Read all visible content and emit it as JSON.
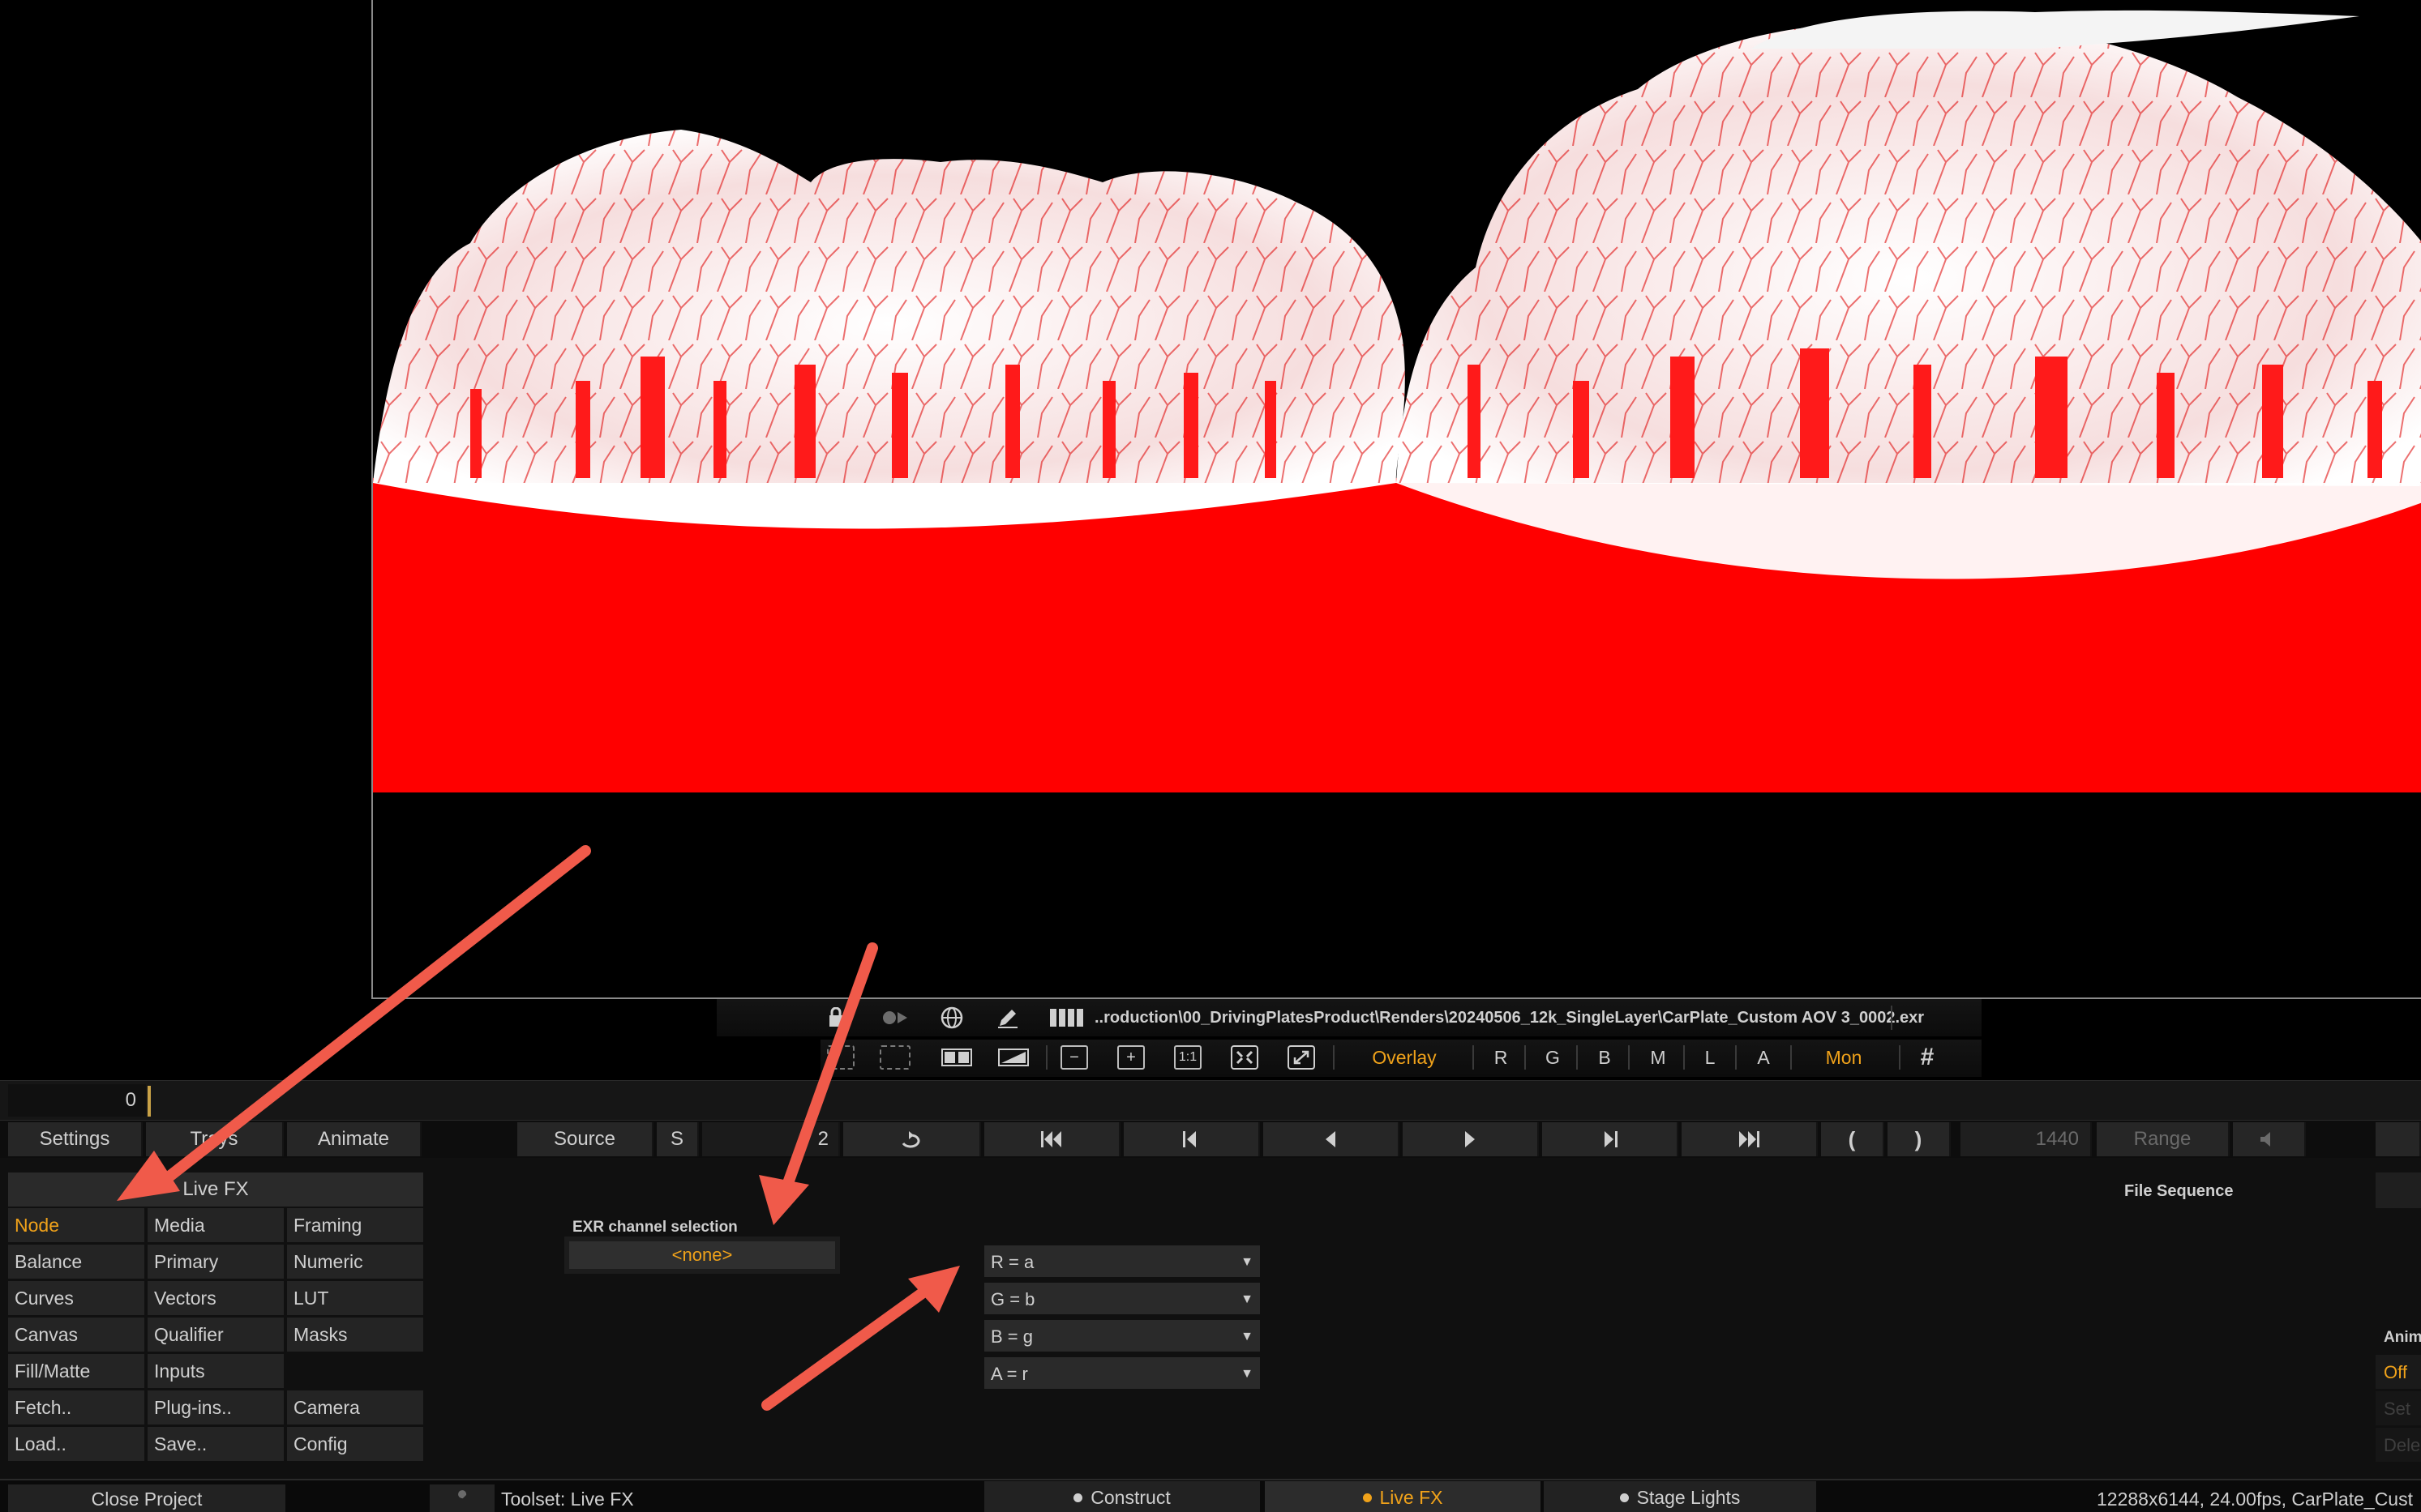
{
  "viewer": {
    "file_path": "..roduction\\00_DrivingPlatesProduct\\Renders\\20240506_12k_SingleLayer\\CarPlate_Custom AOV 3_0002.exr",
    "overlay_label": "Overlay",
    "channels": [
      "R",
      "G",
      "B",
      "M",
      "L",
      "A"
    ],
    "mon_label": "Mon",
    "zoom_1to1": "1:1",
    "icons": [
      "lock-icon",
      "record-icon",
      "globe-icon",
      "pen-icon",
      "filmstrip-icon",
      "safe-area-icon",
      "frame-icon",
      "split-view-icon",
      "gradient-icon",
      "zoom-out-icon",
      "zoom-in-icon",
      "fit-icon",
      "fullscreen-icon",
      "grid-icon"
    ],
    "accent": "#f0a21a",
    "plate_color": "#ff0000"
  },
  "timeline": {
    "frame": "0"
  },
  "transport": {
    "settings": "Settings",
    "trays": "Trays",
    "animate": "Animate",
    "source": "Source",
    "s": "S",
    "current_frame": "2",
    "end_frame": "1440",
    "range": "Range"
  },
  "menu": {
    "header": "Live FX",
    "items": [
      [
        "Node",
        "Media",
        "Framing"
      ],
      [
        "Balance",
        "Primary",
        "Numeric"
      ],
      [
        "Curves",
        "Vectors",
        "LUT"
      ],
      [
        "Canvas",
        "Qualifier",
        "Masks"
      ],
      [
        "Fill/Matte",
        "Inputs",
        ""
      ],
      [
        "Fetch..",
        "Plug-ins..",
        "Camera"
      ],
      [
        "Load..",
        "Save..",
        "Config"
      ]
    ],
    "active_item": "Node"
  },
  "panel": {
    "exr_label": "EXR channel selection",
    "exr_value": "<none>",
    "mappings": [
      "R = a",
      "G = b",
      "B = g",
      "A = r"
    ],
    "file_sequence": "File Sequence",
    "anim_label": "Anim",
    "off_label": "Off",
    "set_label": "Set",
    "dele_label": "Dele"
  },
  "statusbar": {
    "close_project": "Close Project",
    "toolset": "Toolset: Live FX",
    "tabs": [
      "Construct",
      "Live FX",
      "Stage Lights"
    ],
    "active_tab": "Live FX",
    "info": "12288x6144, 24.00fps, CarPlate_Cust"
  },
  "annotation_color": "#f05a4a"
}
